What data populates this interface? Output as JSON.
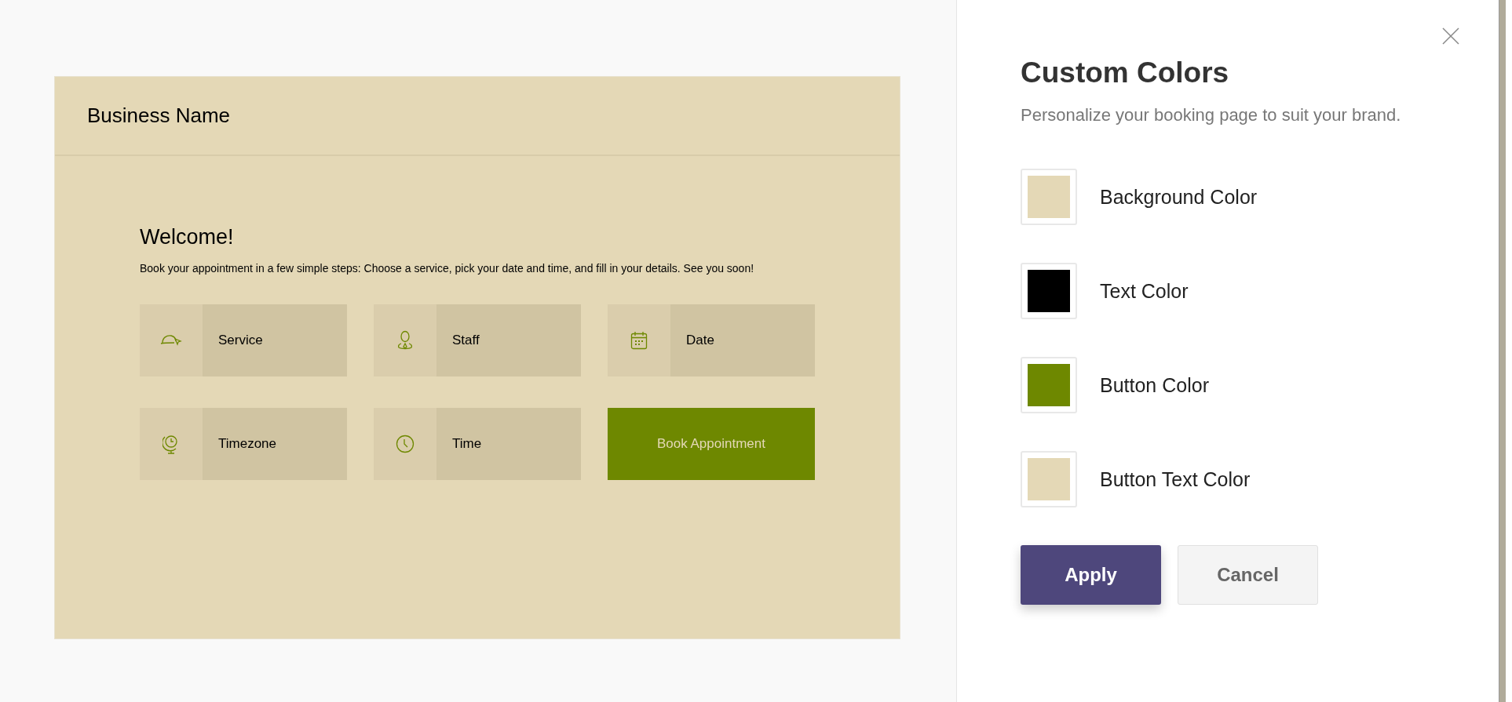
{
  "preview": {
    "business_name": "Business Name",
    "heading": "Welcome!",
    "description": "Book your appointment in a few simple steps: Choose a service, pick your date and time, and fill in your details. See you soon!",
    "tiles": [
      {
        "kind": "option",
        "label": "Service"
      },
      {
        "kind": "option",
        "label": "Staff"
      },
      {
        "kind": "option",
        "label": "Date"
      },
      {
        "kind": "option",
        "label": "Timezone"
      },
      {
        "kind": "option",
        "label": "Time"
      },
      {
        "kind": "button",
        "label": "Book Appointment"
      }
    ]
  },
  "panel": {
    "title": "Custom Colors",
    "subtitle": "Personalize your booking page to suit your brand.",
    "colors": [
      {
        "label": "Background Color",
        "color": "#e4d8b6"
      },
      {
        "label": "Text Color",
        "color": "#000000"
      },
      {
        "label": "Button Color",
        "color": "#6e8800"
      },
      {
        "label": "Button Text Color",
        "color": "#e4d8b6"
      }
    ],
    "buttons": [
      {
        "kind": "primary",
        "label": "Apply"
      },
      {
        "kind": "secondary",
        "label": "Cancel"
      }
    ]
  }
}
